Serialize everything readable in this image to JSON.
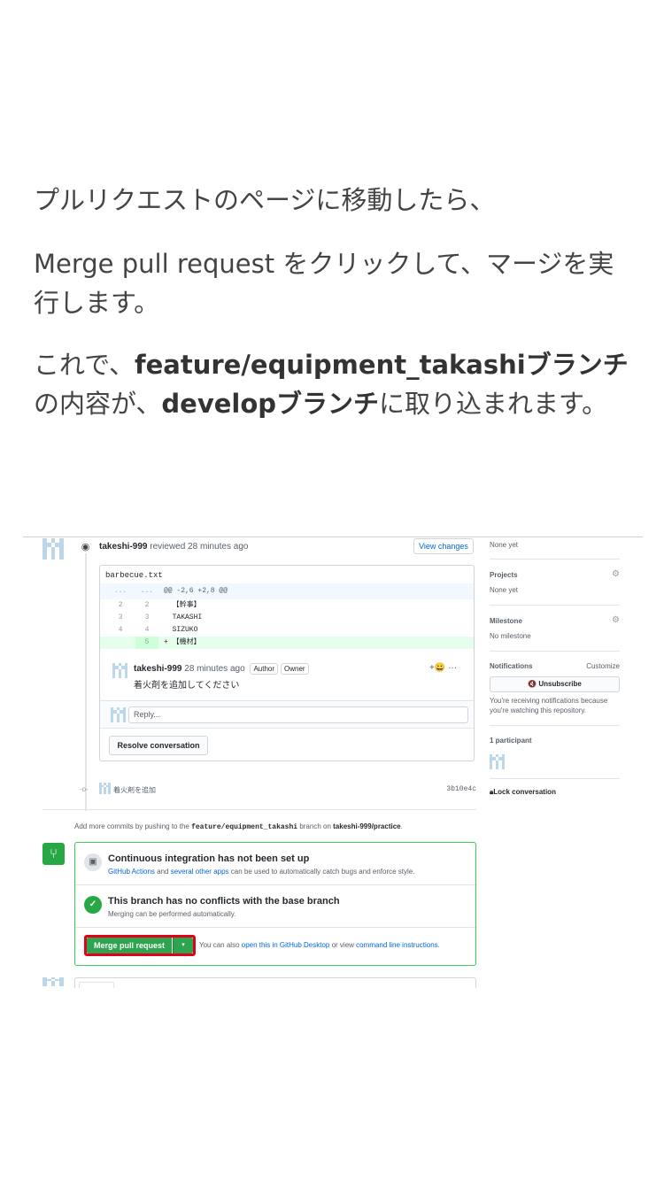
{
  "slide": {
    "line1": "プルリクエストのページに移動したら、",
    "line2": "Merge pull request をクリックして、マージを実行します。",
    "line3_prefix": "これで、",
    "line3_branch1": "feature/equipment_takashiブランチ",
    "line3_mid": "の内容が、",
    "line3_branch2": "developブランチ",
    "line3_suffix": "に取り込まれます。"
  },
  "review": {
    "user": "takeshi-999",
    "action": " reviewed 28 minutes ago",
    "view_changes": "View changes"
  },
  "file": {
    "name": "barbecue.txt",
    "hunk_dots1": "...",
    "hunk_dots2": "...",
    "hunk": "@@ -2,6 +2,8 @@",
    "rows": [
      {
        "n1": "2",
        "n2": "2",
        "code": "  【幹事】"
      },
      {
        "n1": "3",
        "n2": "3",
        "code": "  TAKASHI"
      },
      {
        "n1": "4",
        "n2": "4",
        "code": "  SIZUKO"
      },
      {
        "n1": "",
        "n2": "5",
        "code": "+ 【機材】"
      }
    ]
  },
  "comment": {
    "user": "takeshi-999",
    "time": " 28 minutes ago",
    "badge_author": "Author",
    "badge_owner": "Owner",
    "reactions": "+😀  ···",
    "body": "着火剤を追加してください"
  },
  "reply": {
    "placeholder": "Reply..."
  },
  "resolve": {
    "label": "Resolve conversation"
  },
  "commit": {
    "message": "着火剤を追加",
    "sha": "3b10e4c"
  },
  "push_note": {
    "prefix": "Add more commits by pushing to the ",
    "branch": "feature/equipment_takashi",
    "mid": " branch on ",
    "repo": "takeshi-999/practice",
    "suffix": "."
  },
  "ci": {
    "title": "Continuous integration has not been set up",
    "link1": "GitHub Actions",
    "and": " and ",
    "link2": "several other apps",
    "rest": " can be used to automatically catch bugs and enforce style."
  },
  "conflicts": {
    "title": "This branch has no conflicts with the base branch",
    "sub": "Merging can be performed automatically."
  },
  "merge": {
    "button": "Merge pull request",
    "caret": "▾",
    "alt_prefix": "You can also ",
    "alt_link1": "open this in GitHub Desktop",
    "alt_mid": " or view ",
    "alt_link2": "command line instructions",
    "alt_suffix": "."
  },
  "sidebar": {
    "top_value": "None yet",
    "projects_title": "Projects",
    "projects_value": "None yet",
    "milestone_title": "Milestone",
    "milestone_value": "No milestone",
    "notifications_title": "Notifications",
    "customize": "Customize",
    "unsubscribe": "🔇 Unsubscribe",
    "notify_line1": "You're receiving notifications because",
    "notify_line2": "you're watching this repository.",
    "participants": "1 participant",
    "lock": "Lock conversation"
  },
  "colors": {
    "merge_green": "#2ea44f",
    "highlight_red": "#e0001a",
    "link_blue": "#0366d6"
  }
}
